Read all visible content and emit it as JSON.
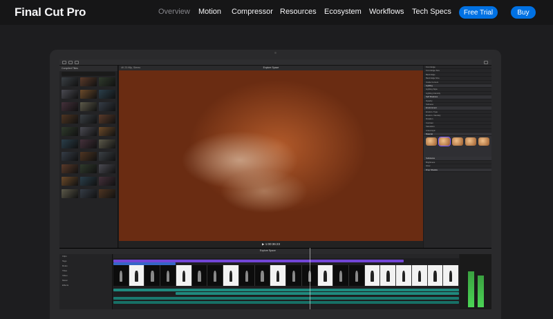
{
  "nav": {
    "brand": "Final Cut Pro",
    "links": [
      "Overview",
      "Motion",
      "Compressor",
      "Resources",
      "Ecosystem",
      "Workflows",
      "Tech Specs"
    ],
    "active_link": "Overview",
    "free_trial": "Free Trial",
    "buy": "Buy"
  },
  "app": {
    "browser_title": "Compiled Titles",
    "viewer_title": "Explore Space",
    "viewer_label": "4K 23.98p, Stereo",
    "timecode": "1:00:36:23",
    "timeline_title": "Explore Space",
    "index_rows": [
      "Clips",
      "Tags",
      "Roles",
      "Titles",
      "Video",
      "Music",
      "Effects"
    ],
    "inspector_rows": [
      "Front Edge",
      "Front Edge Size",
      "Back Edge",
      "Back Edge Size",
      "Inside Corners",
      "Lighting",
      "Lighting Style",
      "Lighting Intensity",
      "Self Shadows",
      "Opacity",
      "Softness",
      "Environment",
      "Environ. Type",
      "Environ. Intensity",
      "Rotation",
      "Contrast",
      "Saturation",
      "Anisotropic",
      "Material",
      "Substance",
      "Brightness",
      "Glow",
      "Drop Shadow"
    ],
    "materials": [
      "Metal",
      "Aluminum",
      "Brass",
      "Bronze",
      "Copper"
    ]
  },
  "colors": {
    "accent": "#0071e3",
    "nav_bg": "#161617",
    "page_bg": "#1d1d1f"
  }
}
